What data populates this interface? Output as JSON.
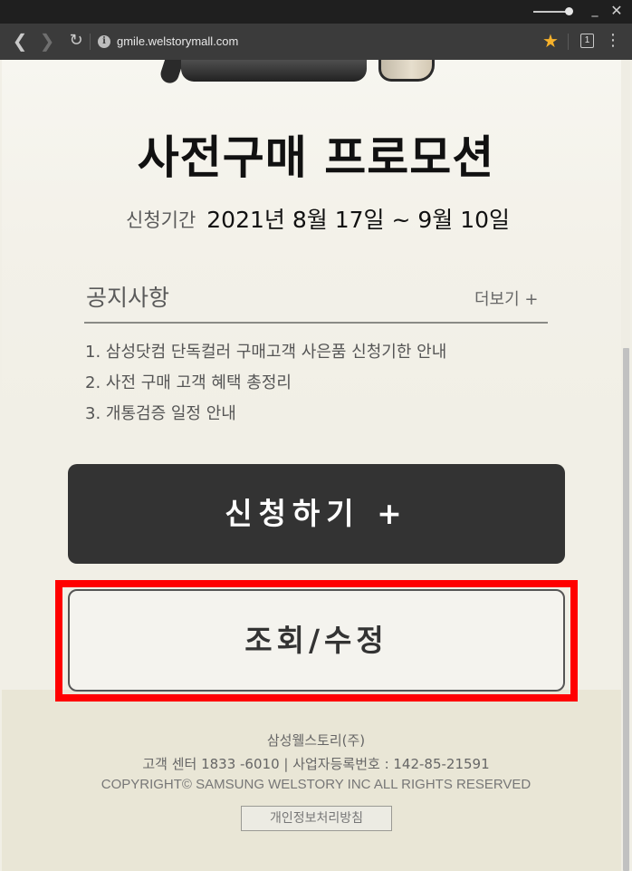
{
  "browser": {
    "url": "gmile.welstorymall.com",
    "tab_count": "1",
    "window_controls": {
      "minimize": "_",
      "close": "✕"
    },
    "icons": {
      "back": "back-icon",
      "forward": "forward-icon",
      "reload": "reload-icon",
      "info": "info-icon",
      "bookmark": "star-icon",
      "menu": "menu-icon"
    },
    "accent": "#f6b12b"
  },
  "page": {
    "promo_title": "사전구매 프로모션",
    "period_label": "신청기간",
    "period_value": "2021년 8월 17일 ~ 9월 10일",
    "notice": {
      "title": "공지사항",
      "more_link": "더보기 +",
      "items": [
        "1.  삼성닷컴 단독컬러 구매고객 사은품 신청기한 안내",
        "2. 사전 구매 고객 혜택 총정리",
        "3. 개통검증 일정 안내"
      ]
    },
    "apply_button": "신청하기 +",
    "inquiry_button": "조회/수정",
    "highlight_color": "#ff0000",
    "footer": {
      "company": "삼성웰스토리(주)",
      "contact": "고객 센터 1833 -6010 | 사업자등록번호 : 142-85-21591",
      "copyright": "COPYRIGHT© SAMSUNG WELSTORY INC ALL RIGHTS RESERVED",
      "privacy_button": "개인정보처리방침"
    }
  }
}
